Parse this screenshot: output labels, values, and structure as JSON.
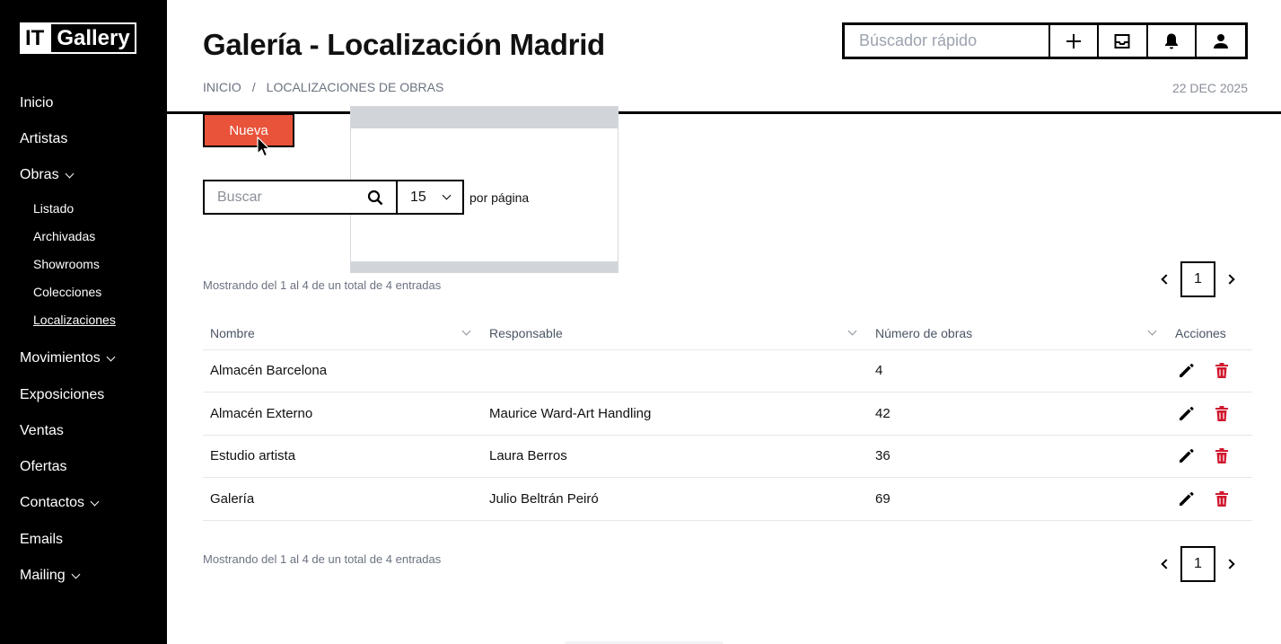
{
  "sidebar": {
    "logo": {
      "part1": "IT",
      "part2": "Gallery"
    },
    "items": [
      {
        "label": "Inicio"
      },
      {
        "label": "Artistas"
      },
      {
        "label": "Obras"
      },
      {
        "label": "Movimientos"
      },
      {
        "label": "Exposiciones"
      },
      {
        "label": "Ventas"
      },
      {
        "label": "Ofertas"
      },
      {
        "label": "Contactos"
      },
      {
        "label": "Emails"
      },
      {
        "label": "Mailing"
      }
    ],
    "obras_sub": [
      {
        "label": "Listado"
      },
      {
        "label": "Archivadas"
      },
      {
        "label": "Showrooms"
      },
      {
        "label": "Colecciones"
      },
      {
        "label": "Localizaciones"
      }
    ]
  },
  "header": {
    "title": "Galería - Localización Madrid",
    "breadcrumb": [
      "INICIO",
      "/",
      "LOCALIZACIONES DE OBRAS"
    ],
    "date": "22 DEC 2025",
    "quick_search_placeholder": "Búscador rápido"
  },
  "toolbar": {
    "new_label": "Nueva",
    "search_placeholder": "Buscar",
    "per_page_value": "15",
    "per_page_label": "por página"
  },
  "showing_top": "Mostrando del 1 al 4 de un total de 4 entradas",
  "showing_bottom": "Mostrando del 1 al 4 de un total de 4 entradas",
  "pagination": {
    "current": "1"
  },
  "table": {
    "headers": [
      "Nombre",
      "Responsable",
      "Número de obras",
      "Acciones"
    ],
    "rows": [
      {
        "nombre": "Almacén Barcelona",
        "responsable": "",
        "numero": "4"
      },
      {
        "nombre": "Almacén Externo",
        "responsable": "Maurice Ward-Art Handling",
        "numero": "42"
      },
      {
        "nombre": "Estudio artista",
        "responsable": "Laura Berros",
        "numero": "36"
      },
      {
        "nombre": "Galería",
        "responsable": "Julio Beltrán Peiró",
        "numero": "69"
      }
    ]
  },
  "colors": {
    "accent": "#e8533a",
    "delete": "#d0182e",
    "sidebar_bg": "#000000"
  },
  "icons": [
    "plus-icon",
    "inbox-icon",
    "bell-icon",
    "user-icon",
    "search-icon",
    "pencil-icon",
    "trash-icon",
    "chevron-down-icon",
    "chevron-left-icon",
    "chevron-right-icon"
  ]
}
